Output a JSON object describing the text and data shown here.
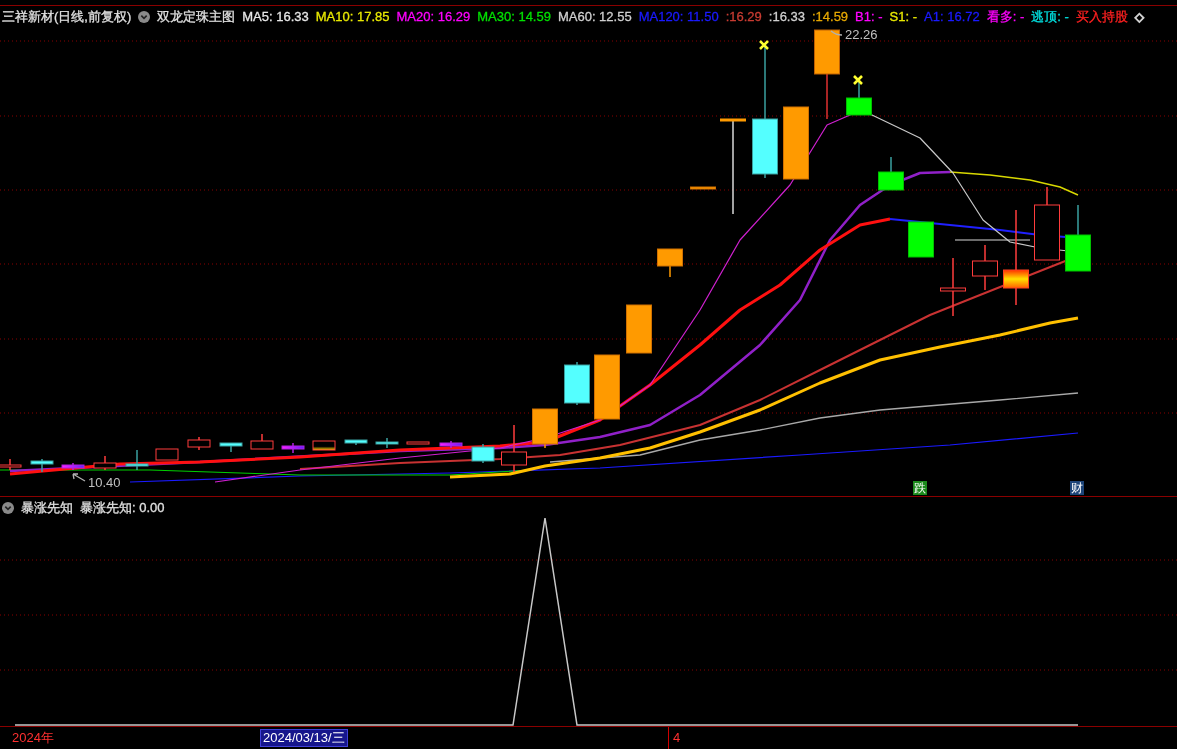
{
  "header": {
    "stock": "三祥新材(日线,前复权)",
    "indicator": "双龙定珠主图",
    "values": [
      {
        "label": "MA5: 16.33",
        "color": "#e6e6e6",
        "kind": "text"
      },
      {
        "label": "MA10: 17.85",
        "color": "#e8e800",
        "kind": "text"
      },
      {
        "label": "MA20: 16.29",
        "color": "#ff00ff",
        "kind": "text"
      },
      {
        "label": "MA30: 14.59",
        "color": "#00e000",
        "kind": "text"
      },
      {
        "label": "MA60: 12.55",
        "color": "#d0d0d0",
        "kind": "text"
      },
      {
        "label": "MA120: 11.50",
        "color": "#1a1aff",
        "kind": "text"
      },
      {
        "label": ":16.29",
        "color": "#c83c32",
        "kind": "text"
      },
      {
        "label": ":16.33",
        "color": "#d0d0d0",
        "kind": "text"
      },
      {
        "label": ":14.59",
        "color": "#e6a800",
        "kind": "text"
      },
      {
        "label": "B1: -",
        "color": "#ff00ff",
        "kind": "text"
      },
      {
        "label": "S1: -",
        "color": "#e8e800",
        "kind": "text"
      },
      {
        "label": "A1: 16.72",
        "color": "#1a1aff",
        "kind": "text"
      },
      {
        "label": "看多: -",
        "color": "#ff00ff",
        "kind": "text"
      },
      {
        "label": "逃顶: -",
        "color": "#00e0e0",
        "kind": "text"
      },
      {
        "label": "买入持股",
        "color": "#ff2020",
        "kind": "text"
      },
      {
        "label": "◇",
        "color": "#d0d0d0",
        "kind": "symbol"
      }
    ]
  },
  "main_chart": {
    "high_label": "22.26",
    "low_label": "10.40",
    "tags": [
      {
        "label": "跌",
        "color": "#1c8a1c"
      },
      {
        "label": "财",
        "color": "#1d4478"
      }
    ]
  },
  "sub_panel": {
    "title": "暴涨先知",
    "reading": "暴涨先知: 0.00"
  },
  "time_axis": {
    "year": "2024年",
    "cursor_date": "2024/03/13/三",
    "month": "4"
  }
}
